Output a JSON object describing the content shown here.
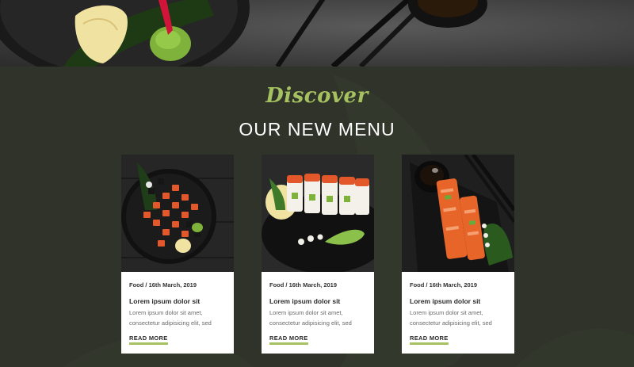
{
  "section": {
    "script_title": "Discover",
    "title": "OUR NEW MENU"
  },
  "cards": [
    {
      "meta": "Food / 16th March, 2019",
      "title": "Lorem ipsum dolor sit",
      "text": "Lorem ipsum dolor sit amet, consectetur adipisicing elit, sed",
      "link": "READ MORE"
    },
    {
      "meta": "Food / 16th March, 2019",
      "title": "Lorem ipsum dolor sit",
      "text": "Lorem ipsum dolor sit amet, consectetur adipisicing elit, sed",
      "link": "READ MORE"
    },
    {
      "meta": "Food / 16th March, 2019",
      "title": "Lorem ipsum dolor sit",
      "text": "Lorem ipsum dolor sit amet, consectetur adipisicing elit, sed",
      "link": "READ MORE"
    }
  ],
  "colors": {
    "accent": "#a6c160",
    "section_bg": "#2f3329"
  }
}
